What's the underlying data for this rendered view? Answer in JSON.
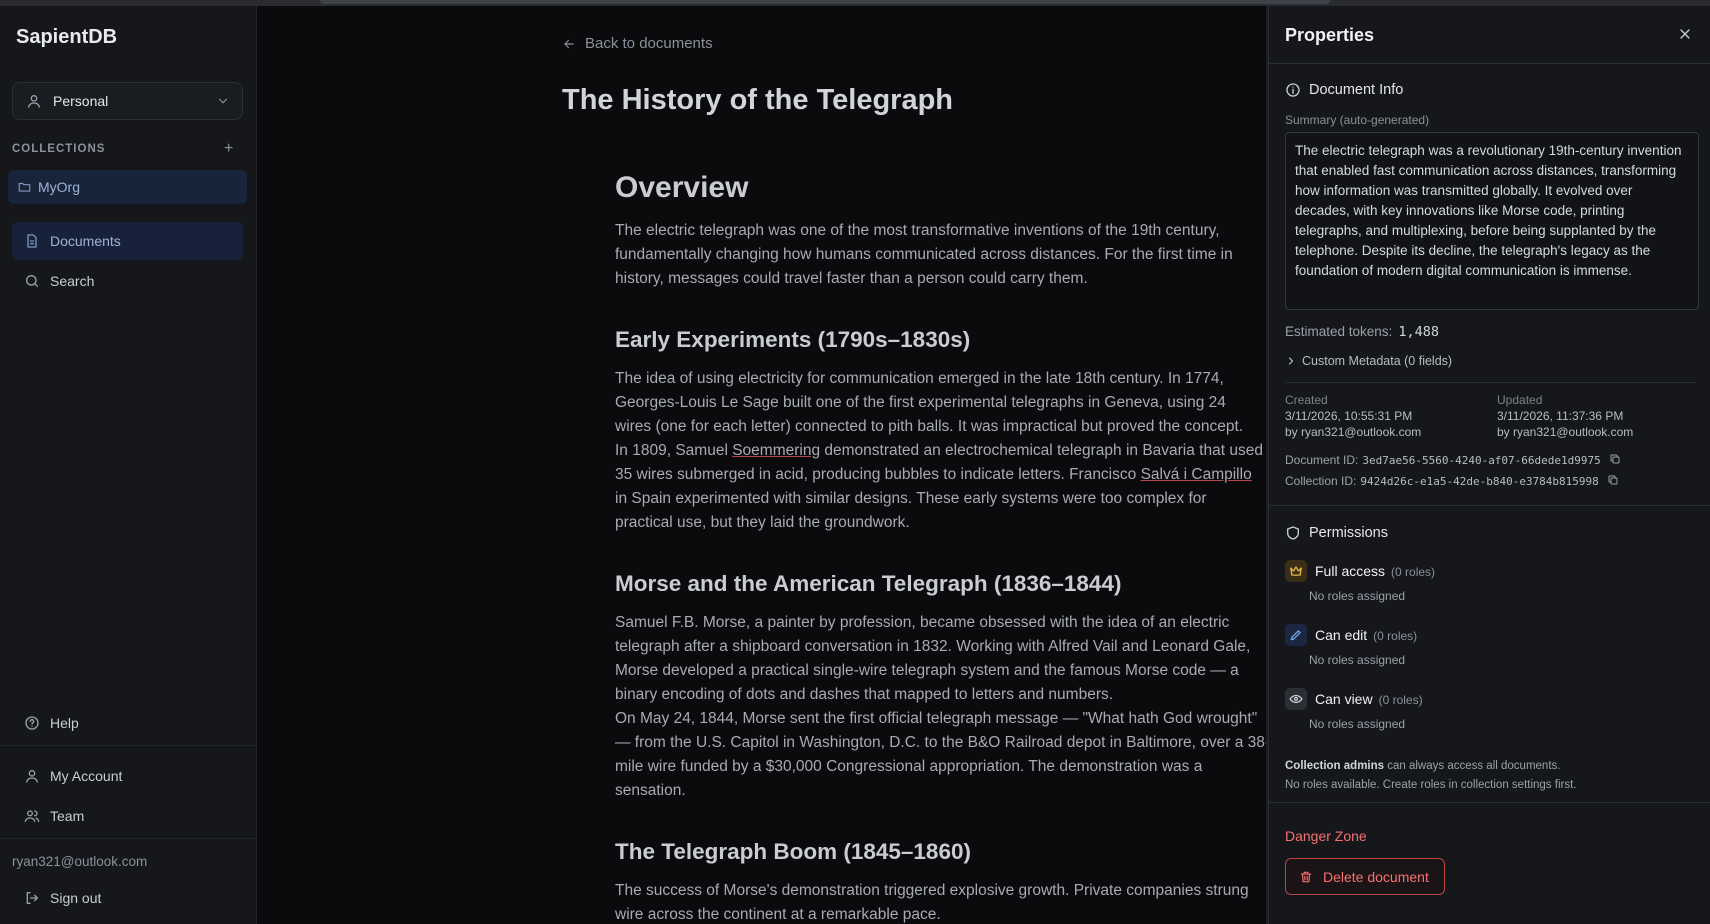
{
  "app": {
    "name": "SapientDB"
  },
  "sidebar": {
    "workspace": "Personal",
    "collections_heading": "COLLECTIONS",
    "collections": [
      {
        "label": "MyOrg"
      }
    ],
    "nav": [
      {
        "label": "Documents"
      },
      {
        "label": "Search"
      }
    ],
    "bottom_nav": [
      {
        "label": "Help"
      },
      {
        "label": "My Account"
      },
      {
        "label": "Team"
      }
    ],
    "user_email": "ryan321@outlook.com",
    "sign_out": "Sign out"
  },
  "document": {
    "back_label": "Back to documents",
    "title": "The History of the Telegraph",
    "overview_heading": "Overview",
    "overview_text": "The electric telegraph was one of the most transformative inventions of the 19th century,\nfundamentally changing how humans communicated across distances. For the first time in\nhistory, messages could travel faster than a person could carry them.",
    "early_heading": "Early Experiments (1790s–1830s)",
    "early_text_1": "The idea of using electricity for communication emerged in the late 18th century. In 1774,\nGeorges-Louis Le Sage built one of the first experimental telegraphs in Geneva, using 24\nwires (one for each letter) connected to pith balls. It was impractical but proved the concept.\nIn 1809, Samuel ",
    "early_name_1": "Soemmering",
    "early_text_2": " demonstrated an electrochemical telegraph in Bavaria that used\n35 wires submerged in acid, producing bubbles to indicate letters. Francisco ",
    "early_name_2": "Salvá i Campillo",
    "early_text_3": "\nin Spain experimented with similar designs. These early systems were too complex for\npractical use, but they laid the groundwork.",
    "morse_heading": "Morse and the American Telegraph (1836–1844)",
    "morse_text": "Samuel F.B. Morse, a painter by profession, became obsessed with the idea of an electric\ntelegraph after a shipboard conversation in 1832. Working with Alfred Vail and Leonard Gale,\nMorse developed a practical single-wire telegraph system and the famous Morse code — a\nbinary encoding of dots and dashes that mapped to letters and numbers.\nOn May 24, 1844, Morse sent the first official telegraph message — \"What hath God wrought\"\n— from the U.S. Capitol in Washington, D.C. to the B&O Railroad depot in Baltimore, over a 38-\nmile wire funded by a $30,000 Congressional appropriation. The demonstration was a\nsensation.",
    "boom_heading": "The Telegraph Boom (1845–1860)",
    "boom_text": "The success of Morse's demonstration triggered explosive growth. Private companies strung\nwire across the continent at a remarkable pace."
  },
  "properties": {
    "title": "Properties",
    "doc_info_heading": "Document Info",
    "summary_label": "Summary (auto-generated)",
    "summary": "The electric telegraph was a revolutionary 19th-century invention that enabled fast communication across distances, transforming how information was transmitted globally. It evolved over decades, with key innovations like Morse code, printing telegraphs, and multiplexing, before being supplanted by the telephone. Despite its decline, the telegraph's legacy as the foundation of modern digital communication is immense.",
    "tokens_label": "Estimated tokens:",
    "tokens_value": "1,488",
    "custom_metadata": "Custom Metadata (0 fields)",
    "created_label": "Created",
    "created_date": "3/11/2026, 10:55:31 PM",
    "created_by": "by ryan321@outlook.com",
    "updated_label": "Updated",
    "updated_date": "3/11/2026, 11:37:36 PM",
    "updated_by": "by ryan321@outlook.com",
    "doc_id_label": "Document ID:",
    "doc_id": "3ed7ae56-5560-4240-af07-66dede1d9975",
    "coll_id_label": "Collection ID:",
    "coll_id": "9424d26c-e1a5-42de-b840-e3784b815998",
    "permissions_heading": "Permissions",
    "permissions": [
      {
        "name": "Full access",
        "count": "(0 roles)",
        "none": "No roles assigned"
      },
      {
        "name": "Can edit",
        "count": "(0 roles)",
        "none": "No roles assigned"
      },
      {
        "name": "Can view",
        "count": "(0 roles)",
        "none": "No roles assigned"
      }
    ],
    "admins_strong": "Collection admins",
    "admins_text": " can always access all documents.",
    "no_roles_text": "No roles available. Create roles in collection settings first.",
    "danger_heading": "Danger Zone",
    "delete_label": "Delete document"
  },
  "colors": {
    "accent": "#9fb3d6",
    "danger": "#f87171",
    "gold": "#e5b649",
    "edit": "#7aa7f0"
  }
}
